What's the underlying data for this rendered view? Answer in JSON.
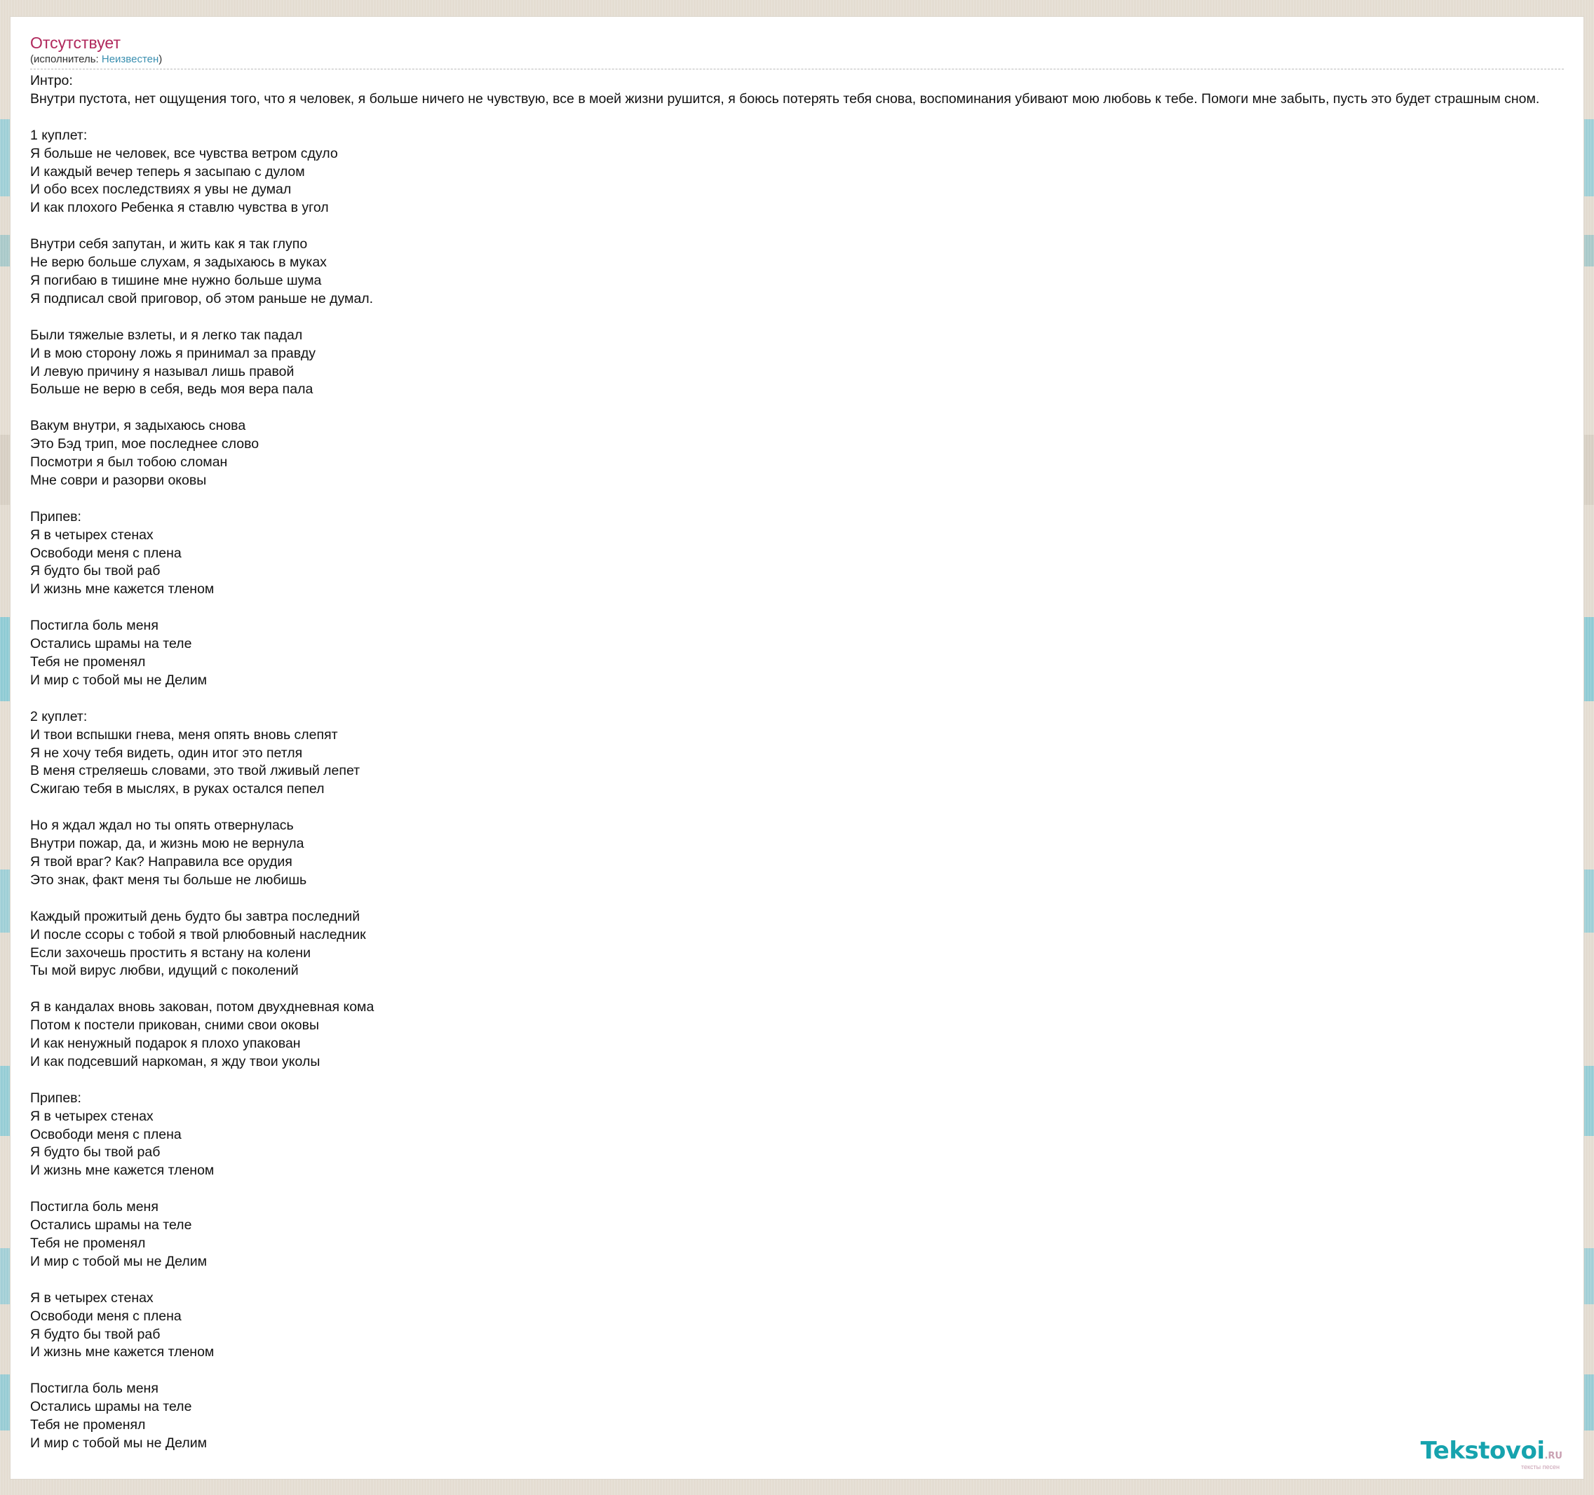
{
  "song": {
    "title": "Отсутствует",
    "artist_prefix": "(исполнитель: ",
    "artist_name": "Неизвестен",
    "artist_suffix": ")"
  },
  "lyrics": [
    "Интро:",
    "Внутри пустота, нет ощущения того, что я человек, я больше ничего не чувствую, все в моей жизни рушится, я боюсь потерять тебя снова, воспоминания убивают мою любовь к тебе. Помоги мне забыть, пусть это будет страшным сном.",
    "",
    "1 куплет:",
    "Я больше не человек, все чувства ветром сдуло",
    "И каждый вечер теперь я засыпаю с дулом",
    "И обо всех последствиях я увы не думал",
    "И как плохого Ребенка я ставлю чувства в угол",
    "",
    "Внутри себя запутан, и жить как я так глупо",
    "Не верю больше слухам, я задыхаюсь в муках",
    "Я погибаю в тишине мне нужно больше шума",
    "Я подписал свой приговор, об этом раньше не думал.",
    "",
    "Были тяжелые взлеты, и я легко так падал",
    "И в мою сторону ложь я принимал за правду",
    "И левую причину я называл лишь правой",
    "Больше не верю в себя, ведь моя вера пала",
    "",
    "Вакум внутри, я задыхаюсь снова",
    "Это Бэд трип, мое последнее слово",
    "Посмотри я был тобою сломан",
    "Мне соври и разорви оковы",
    "",
    "Припев:",
    "Я в четырех стенах",
    "Освободи меня с плена",
    "Я будто бы твой раб",
    "И жизнь мне кажется тленом",
    "",
    "Постигла боль меня",
    "Остались шрамы на теле",
    "Тебя не променял",
    "И мир с тобой мы не Делим",
    "",
    "2 куплет:",
    "И твои вспышки гнева, меня опять вновь слепят",
    "Я не хочу тебя видеть, один итог это петля",
    "В меня стреляешь словами, это твой лживый лепет",
    "Сжигаю тебя в мыслях, в руках остался пепел",
    "",
    "Но я ждал ждал но ты опять отвернулась",
    "Внутри пожар, да, и жизнь мою не вернула",
    "Я твой враг? Как? Направила все орудия",
    "Это знак, факт меня ты больше не любишь",
    "",
    "Каждый прожитый день будто бы завтра последний",
    "И после ссоры с тобой я твой рлюбовный наследник",
    "Если захочешь простить я встану на колени",
    "Ты мой вирус любви, идущий с поколений",
    "",
    "Я в кандалах вновь закован, потом двухдневная кома",
    "Потом к постели прикован, сними свои оковы",
    "И как ненужный подарок я плохо упакован",
    "И как подсевший наркоман, я жду твои уколы",
    "",
    "Припев:",
    "Я в четырех стенах",
    "Освободи меня с плена",
    "Я будто бы твой раб",
    "И жизнь мне кажется тленом",
    "",
    "Постигла боль меня",
    "Остались шрамы на теле",
    "Тебя не променял",
    "И мир с тобой мы не Делим",
    "",
    "Я в четырех стенах",
    "Освободи меня с плена",
    "Я будто бы твой раб",
    "И жизнь мне кажется тленом",
    "",
    "Постигла боль меня",
    "Остались шрамы на теле",
    "Тебя не променял",
    "И мир с тобой мы не Делим"
  ],
  "logo": {
    "main": "Tekstovoi",
    "suffix": ".RU",
    "tagline": "тексты песен"
  },
  "colors": {
    "title": "#b0285c",
    "artist_link": "#3a8fb0",
    "logo": "#16a3ae"
  }
}
